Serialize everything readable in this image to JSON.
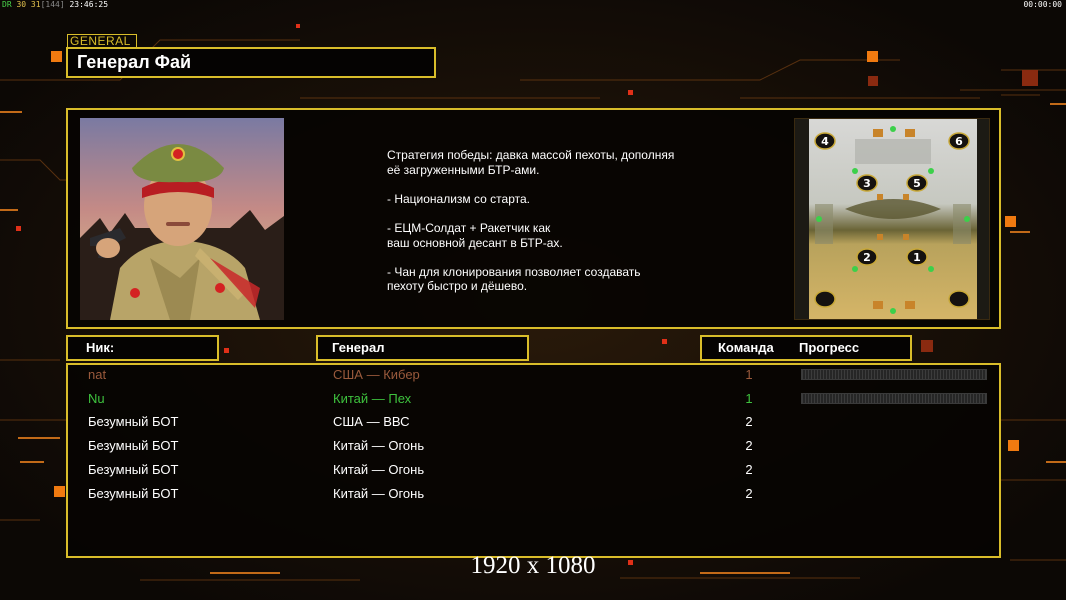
{
  "hud": {
    "left_prefix": "DR",
    "left_fps": "30 31",
    "left_bracket": "[144]",
    "left_time": "23:46:25",
    "right_time": "00:00:00"
  },
  "general": {
    "tag": "GENERAL",
    "name": "Генерал Фай",
    "description": "Стратегия победы: давка массой пехоты, дополняя\n её загруженными БТР-ами.\n\n- Национализм со старта.\n\n- ЕЦМ-Солдат + Ракетчик как\nваш основной десант в БТР-ах.\n\n- Чан для клонирования позволяет создавать\n пехоту быстро и дёшево."
  },
  "map": {
    "start_positions": [
      "4",
      "6",
      "3",
      "5",
      "2",
      "1"
    ]
  },
  "table": {
    "headers": {
      "nick": "Ник:",
      "general": "Генерал",
      "team": "Команда",
      "progress": "Прогресс"
    },
    "rows": [
      {
        "nick": "nat",
        "general": "США — Кибер",
        "team": "1",
        "color": "#9a5a3c",
        "progress": 0.0
      },
      {
        "nick": "Nu",
        "general": "Китай — Пех",
        "team": "1",
        "color": "#3ec23e",
        "progress": 0.0
      },
      {
        "nick": "Безумный БОТ",
        "general": "США — ВВС",
        "team": "2",
        "color": "#ffffff"
      },
      {
        "nick": "Безумный БОТ",
        "general": "Китай — Огонь",
        "team": "2",
        "color": "#ffffff"
      },
      {
        "nick": "Безумный БОТ",
        "general": "Китай — Огонь",
        "team": "2",
        "color": "#ffffff"
      },
      {
        "nick": "Безумный БОТ",
        "general": "Китай — Огонь",
        "team": "2",
        "color": "#ffffff"
      }
    ]
  },
  "resolution_label": "1920 x 1080",
  "colors": {
    "accent_gold": "#d9bd2a",
    "accent_orange": "#f07a10",
    "background": "#100b07"
  }
}
